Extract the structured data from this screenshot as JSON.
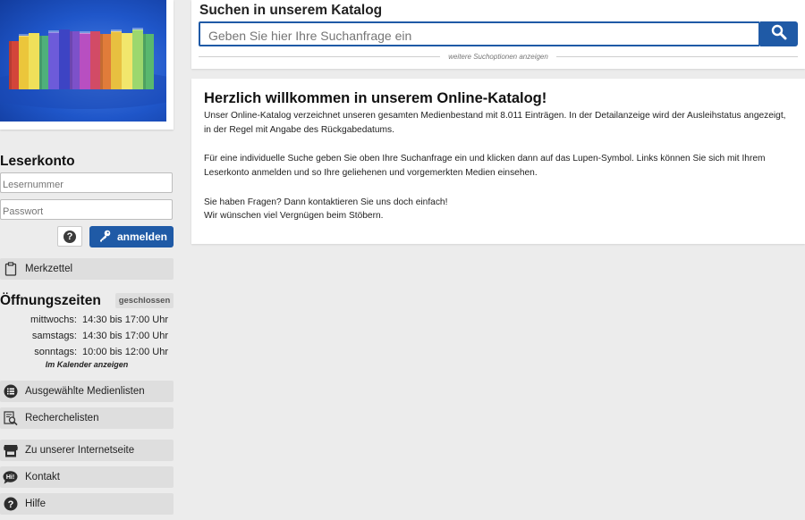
{
  "sidebar": {
    "account": {
      "title": "Leserkonto",
      "reader_number_placeholder": "Lesernummer",
      "password_placeholder": "Passwort",
      "help_label": "?",
      "login_label": "anmelden"
    },
    "notepad_label": "Merkzettel",
    "hours": {
      "title": "Öffnungszeiten",
      "status_badge": "geschlossen",
      "rows": [
        {
          "day": "mittwochs:",
          "time": "14:30 bis 17:00 Uhr"
        },
        {
          "day": "samstags:",
          "time": "14:30 bis 17:00 Uhr"
        },
        {
          "day": "sonntags:",
          "time": "10:00 bis 12:00 Uhr"
        }
      ],
      "calendar_link": "Im Kalender anzeigen"
    },
    "links": [
      {
        "label": "Ausgewählte Medienlisten",
        "icon": "list-icon"
      },
      {
        "label": "Recherchelisten",
        "icon": "search-list-icon"
      },
      {
        "label": "Zu unserer Internetseite",
        "icon": "store-icon"
      },
      {
        "label": "Kontakt",
        "icon": "hi-chat-icon"
      },
      {
        "label": "Hilfe",
        "icon": "question-icon"
      }
    ]
  },
  "search": {
    "title": "Suchen in unserem Katalog",
    "placeholder": "Geben Sie hier Ihre Suchanfrage ein",
    "more_options": "weitere Suchoptionen anzeigen"
  },
  "welcome": {
    "title": "Herzlich willkommen in unserem Online-Katalog!",
    "paragraph1": "Unser Online-Katalog verzeichnet unseren gesamten Medienbestand mit 8.011 Einträgen. In der Detailanzeige wird der Ausleihstatus angezeigt, in der Regel mit Angabe des Rückgabedatums.",
    "paragraph2": "Für eine individuelle Suche geben Sie oben Ihre Suchanfrage ein und klicken dann auf das Lupen-Symbol. Links können Sie sich mit Ihrem Leserkonto anmelden und so Ihre geliehenen und vorgemerkten Medien einsehen.",
    "paragraph3_line1": "Sie haben Fragen? Dann kontaktieren Sie uns doch einfach!",
    "paragraph3_line2": "Wir wünschen viel Vergnügen beim Stöbern."
  },
  "colors": {
    "accent": "#1f5aa6",
    "background": "#ececec",
    "nav_item": "#dedede"
  }
}
